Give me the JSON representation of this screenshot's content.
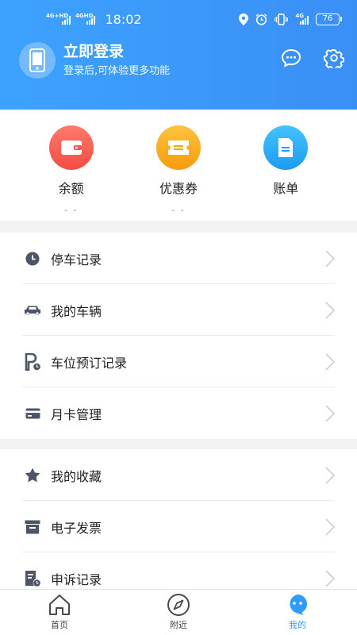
{
  "status_bar": {
    "network1": "4G+HD",
    "network2": "4GHD",
    "time": "18:02",
    "network3": "4G",
    "battery": "76"
  },
  "header": {
    "login_title": "立即登录",
    "login_subtitle": "登录后,可体验更多功能"
  },
  "quick_actions": [
    {
      "label": "余额",
      "value": "- -"
    },
    {
      "label": "优惠券",
      "value": "- -"
    },
    {
      "label": "账单",
      "value": ""
    }
  ],
  "menu_group1": [
    {
      "label": "停车记录",
      "icon": "clock-icon"
    },
    {
      "label": "我的车辆",
      "icon": "car-icon"
    },
    {
      "label": "车位预订记录",
      "icon": "parking-icon"
    },
    {
      "label": "月卡管理",
      "icon": "card-icon"
    }
  ],
  "menu_group2": [
    {
      "label": "我的收藏",
      "icon": "star-icon"
    },
    {
      "label": "电子发票",
      "icon": "invoice-icon"
    },
    {
      "label": "申诉记录",
      "icon": "complaint-icon"
    }
  ],
  "tabbar": [
    {
      "label": "首页",
      "icon": "home-icon",
      "active": false
    },
    {
      "label": "附近",
      "icon": "compass-icon",
      "active": false
    },
    {
      "label": "我的",
      "icon": "profile-icon",
      "active": true
    }
  ],
  "colors": {
    "brand": "#3a96f8",
    "icon_gray": "#4d5566",
    "active_tab": "#2e9bff"
  }
}
